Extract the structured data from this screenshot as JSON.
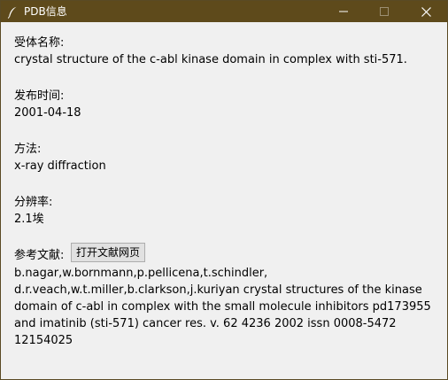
{
  "window": {
    "title": "PDB信息",
    "icon": "feather-icon",
    "title_bar_color": "#5e4a1b",
    "background": "#f0f0f0"
  },
  "fields": {
    "receptor_name_label": "受体名称:",
    "receptor_name_value": " crystal structure of the c-abl kinase domain in complex with sti-571.",
    "release_date_label": "发布时间:",
    "release_date_value": "2001-04-18",
    "method_label": "方法:",
    "method_value": "x-ray diffraction",
    "resolution_label": "分辨率:",
    "resolution_value": "2.1埃",
    "reference_label": "参考文献:",
    "reference_button": "打开文献网页",
    "reference_value": "b.nagar,w.bornmann,p.pellicena,t.schindler, d.r.veach,w.t.miller,b.clarkson,j.kuriyan crystal structures of the kinase domain of c-abl in complex with the small molecule inhibitors pd173955 and imatinib (sti-571) cancer res. v. 62 4236 2002 issn 0008-5472 12154025"
  }
}
